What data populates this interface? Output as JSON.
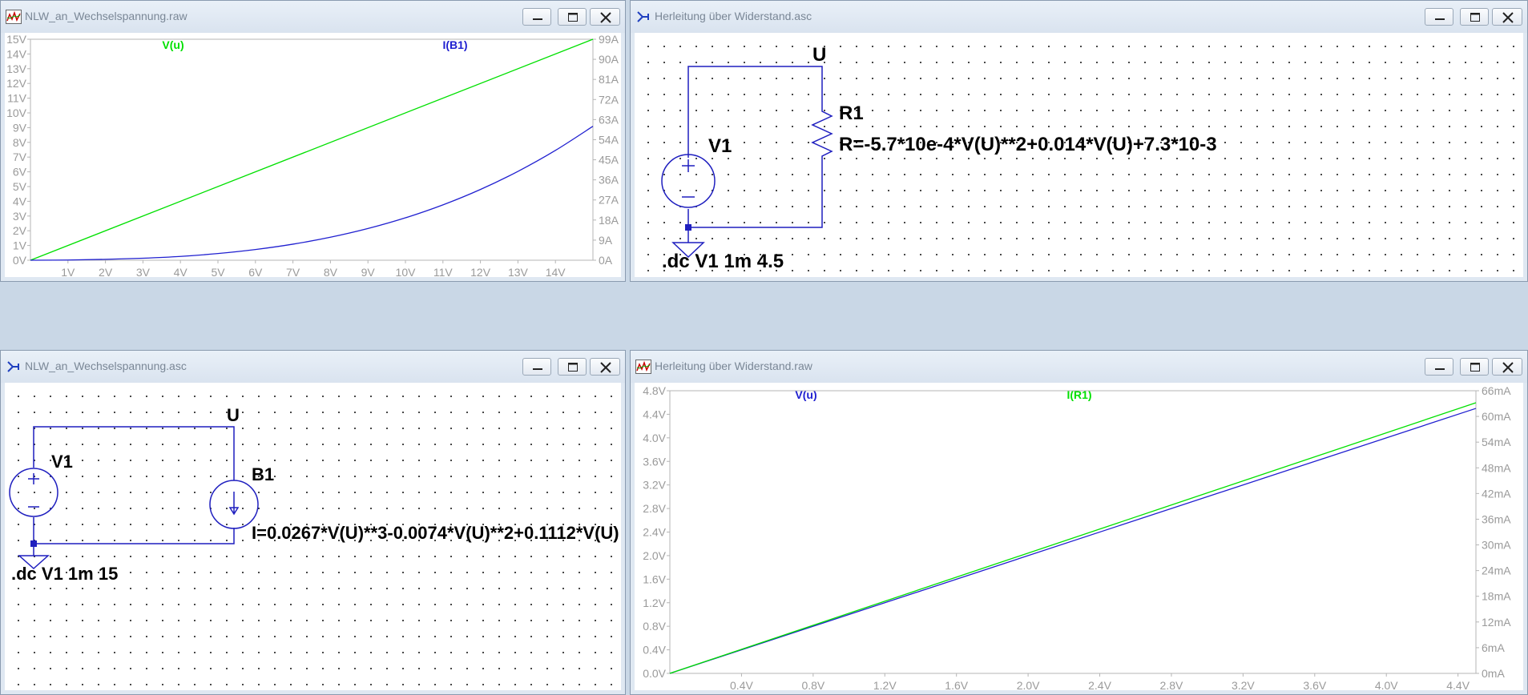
{
  "windows": {
    "raw1": {
      "title": "NLW_an_Wechselspannung.raw",
      "trace_v_label": "V(u)",
      "trace_i_label": "I(B1)"
    },
    "asc1": {
      "title": "Herleitung über Widerstand.asc",
      "net_label": "U",
      "source_label": "V1",
      "resistor_label": "R1",
      "resistor_value": "R=-5.7*10e-4*V(U)**2+0.014*V(U)+7.3*10-3",
      "directive": ".dc V1 1m 4.5"
    },
    "asc2": {
      "title": "NLW_an_Wechselspannung.asc",
      "net_label": "U",
      "source_label": "V1",
      "bsource_label": "B1",
      "bsource_value": "I=0.0267*V(U)**3-0.0074*V(U)**2+0.1112*V(U)",
      "directive": ".dc V1 1m 15"
    },
    "raw2": {
      "title": "Herleitung über Widerstand.raw",
      "trace_v_label": "V(u)",
      "trace_i_label": "I(R1)"
    }
  },
  "colors": {
    "green_trace": "#00e000",
    "blue_trace": "#2020d0",
    "wire": "#1f1fbf"
  },
  "chart_data": [
    {
      "type": "line",
      "window": "NLW_an_Wechselspannung.raw",
      "x_ticks": [
        "1V",
        "2V",
        "3V",
        "4V",
        "5V",
        "6V",
        "7V",
        "8V",
        "9V",
        "10V",
        "11V",
        "12V",
        "13V",
        "14V"
      ],
      "y_left_ticks": [
        "0V",
        "1V",
        "2V",
        "3V",
        "4V",
        "5V",
        "6V",
        "7V",
        "8V",
        "9V",
        "10V",
        "11V",
        "12V",
        "13V",
        "14V",
        "15V"
      ],
      "y_right_ticks": [
        "0A",
        "9A",
        "18A",
        "27A",
        "36A",
        "45A",
        "54A",
        "63A",
        "72A",
        "81A",
        "90A",
        "99A"
      ],
      "xlim": [
        0,
        15
      ],
      "ylim_left": [
        0,
        15
      ],
      "ylim_right": [
        0,
        99
      ],
      "series": [
        {
          "name": "V(u)",
          "axis": "left",
          "x": [
            0,
            15
          ],
          "y": [
            0,
            15
          ]
        },
        {
          "name": "I(B1)",
          "axis": "right",
          "x": [
            0,
            1,
            2,
            3,
            4,
            5,
            6,
            7,
            8,
            9,
            10,
            11,
            12,
            13,
            14,
            15
          ],
          "y": [
            0,
            0.1,
            0.4,
            0.9,
            1.7,
            3.0,
            4.8,
            7.2,
            10.3,
            14.2,
            19.0,
            24.8,
            31.7,
            39.8,
            49.2,
            60.0
          ]
        }
      ]
    },
    {
      "type": "line",
      "window": "Herleitung über Widerstand.raw",
      "x_ticks": [
        "0.4V",
        "0.8V",
        "1.2V",
        "1.6V",
        "2.0V",
        "2.4V",
        "2.8V",
        "3.2V",
        "3.6V",
        "4.0V",
        "4.4V"
      ],
      "y_left_ticks": [
        "0.0V",
        "0.4V",
        "0.8V",
        "1.2V",
        "1.6V",
        "2.0V",
        "2.4V",
        "2.8V",
        "3.2V",
        "3.6V",
        "4.0V",
        "4.4V",
        "4.8V"
      ],
      "y_right_ticks": [
        "0mA",
        "6mA",
        "12mA",
        "18mA",
        "24mA",
        "30mA",
        "36mA",
        "42mA",
        "48mA",
        "54mA",
        "60mA",
        "66mA"
      ],
      "xlim": [
        0,
        4.5
      ],
      "ylim_left": [
        0,
        4.8
      ],
      "ylim_right": [
        0,
        66
      ],
      "series": [
        {
          "name": "V(u)",
          "axis": "left",
          "x": [
            0,
            4.5
          ],
          "y": [
            0,
            4.5
          ]
        },
        {
          "name": "I(R1)",
          "axis": "right",
          "x": [
            0,
            4.5
          ],
          "y": [
            0,
            63.2
          ]
        }
      ]
    }
  ]
}
